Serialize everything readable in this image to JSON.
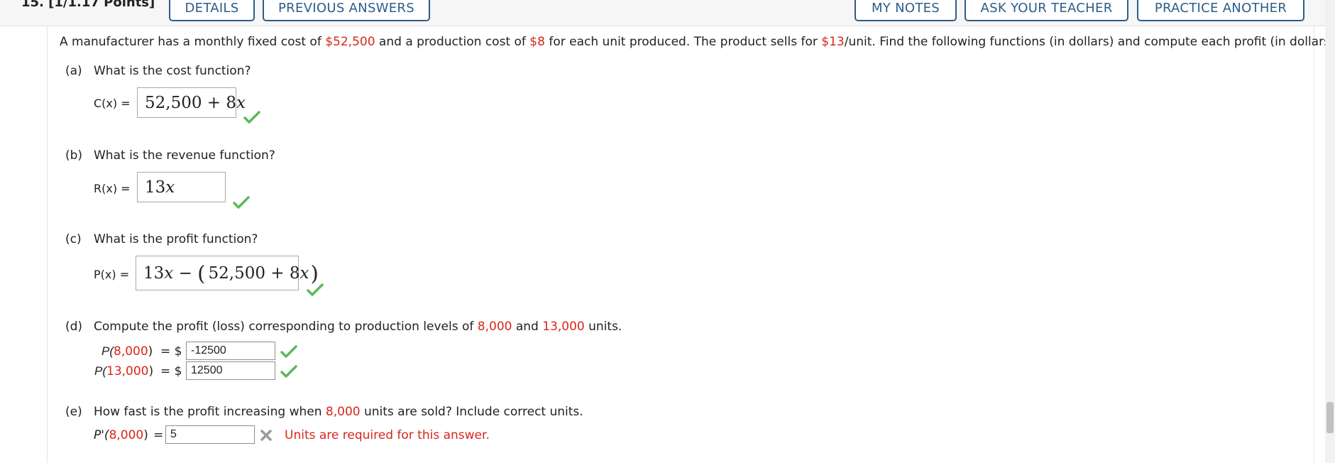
{
  "header": {
    "question_title": "15.  [1/1.17 Points]",
    "buttons": {
      "details": "DETAILS",
      "previous_answers": "PREVIOUS ANSWERS",
      "my_notes": "MY NOTES",
      "ask_teacher": "ASK YOUR TEACHER",
      "practice_another": "PRACTICE ANOTHER"
    }
  },
  "problem": {
    "s1": "A manufacturer has a monthly fixed cost of ",
    "fixed_cost": "$52,500",
    "s2": " and a production cost of ",
    "unit_cost": "$8",
    "s3": " for each unit produced. The product sells for ",
    "price": "$13",
    "s4": "/unit. Find the following functions (in dollars) and compute each profit (in dollars)."
  },
  "part_a": {
    "letter": "(a)",
    "question": "What is the cost function?",
    "label": "C(x) =",
    "answer_num": "52,500",
    "answer_op": " + 8",
    "answer_var": "x"
  },
  "part_b": {
    "letter": "(b)",
    "question": "What is the revenue function?",
    "label": "R(x) =",
    "answer_num": "13",
    "answer_var": "x"
  },
  "part_c": {
    "letter": "(c)",
    "question": "What is the profit function?",
    "label": "P(x) =",
    "ans_13": "13",
    "ans_x1": "x",
    "ans_minus": " − ",
    "ans_open": "(",
    "ans_inner": "52,500 + 8",
    "ans_x2": "x",
    "ans_close": ")"
  },
  "part_d": {
    "letter": "(d)",
    "q1": "Compute the profit (loss) corresponding to production levels of ",
    "level1": "8,000",
    "q2": " and ",
    "level2": "13,000",
    "q3": " units.",
    "row1": {
      "prefix": "P(",
      "arg": "8,000",
      "suffix": ")",
      "eq": "= $",
      "value": "-12500"
    },
    "row2": {
      "prefix": "P(",
      "arg": "13,000",
      "suffix": ")",
      "eq": "= $",
      "value": "12500"
    }
  },
  "part_e": {
    "letter": "(e)",
    "q1": "How fast is the profit increasing when ",
    "level": "8,000",
    "q2": " units are sold? Include correct units.",
    "prefix": "P'(",
    "arg": "8,000",
    "suffix": ")",
    "eq": "=",
    "value": "5",
    "error": "Units are required for this answer."
  },
  "colors": {
    "accent_blue": "#2c5d89",
    "highlight_red": "#d7261b",
    "correct_green": "#5cb85c",
    "incorrect_gray": "#9a9a9a"
  }
}
